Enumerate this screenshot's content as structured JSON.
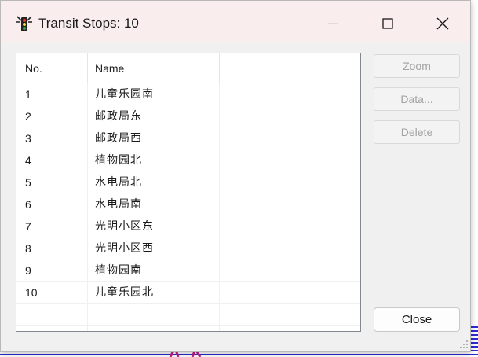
{
  "window": {
    "title": "Transit Stops: 10",
    "icon": "traffic-light-icon",
    "controls": [
      "minimize-icon",
      "maximize-icon",
      "close-icon"
    ]
  },
  "list": {
    "columns": [
      "No.",
      "Name",
      ""
    ],
    "rows": [
      {
        "no": "1",
        "name": "儿童乐园南"
      },
      {
        "no": "2",
        "name": "邮政局东"
      },
      {
        "no": "3",
        "name": "邮政局西"
      },
      {
        "no": "4",
        "name": "植物园北"
      },
      {
        "no": "5",
        "name": "水电局北"
      },
      {
        "no": "6",
        "name": "水电局南"
      },
      {
        "no": "7",
        "name": "光明小区东"
      },
      {
        "no": "8",
        "name": "光明小区西"
      },
      {
        "no": "9",
        "name": "植物园南"
      },
      {
        "no": "10",
        "name": "儿童乐园北"
      }
    ]
  },
  "buttons": {
    "zoom": "Zoom",
    "data": "Data...",
    "delete": "Delete",
    "close": "Close"
  },
  "colors": {
    "titlebar_bg": "#f9eded",
    "window_bg": "#f0f0f0",
    "disabled_text": "#a3a3a3",
    "background_stripe": "#2b2bd6"
  }
}
